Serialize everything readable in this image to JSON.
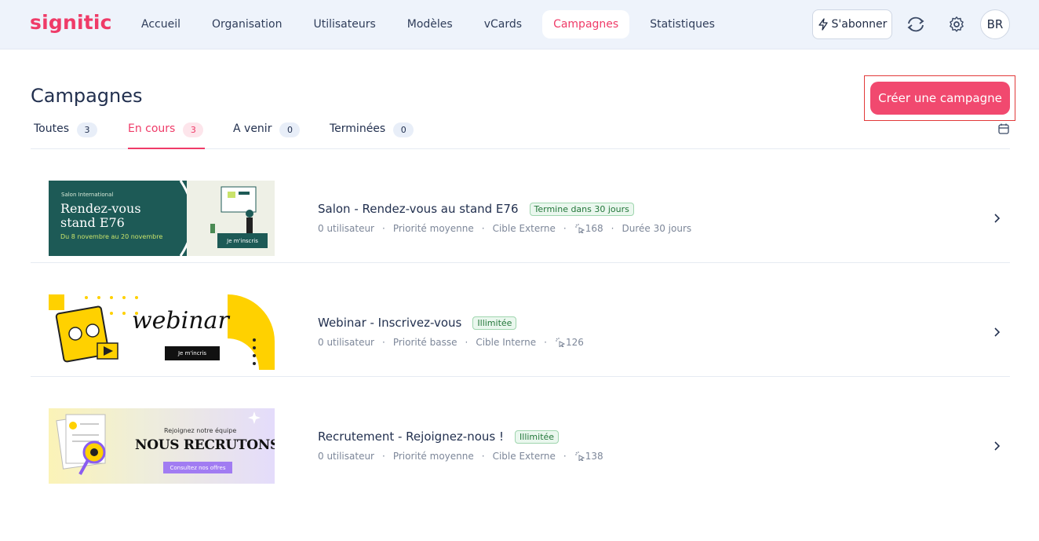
{
  "header": {
    "logo": "signitic",
    "nav": [
      "Accueil",
      "Organisation",
      "Utilisateurs",
      "Modèles",
      "vCards",
      "Campagnes",
      "Statistiques"
    ],
    "active_nav": "Campagnes",
    "subscribe_label": "S'abonner",
    "avatar_initials": "BR"
  },
  "page": {
    "title": "Campagnes",
    "create_label": "Créer une campagne"
  },
  "tabs": [
    {
      "label": "Toutes",
      "count": "3"
    },
    {
      "label": "En cours",
      "count": "3"
    },
    {
      "label": "A venir",
      "count": "0"
    },
    {
      "label": "Terminées",
      "count": "0"
    }
  ],
  "campaigns": [
    {
      "title": "Salon - Rendez-vous au stand E76",
      "status": "Termine dans 30 jours",
      "meta": [
        "0 utilisateur",
        "Priorité moyenne",
        "Cible Externe"
      ],
      "clicks": "168",
      "duration": "Durée 30 jours",
      "banner": {
        "small": "Salon International",
        "line1": "Rendez-vous",
        "line2": "stand E76",
        "dates": "Du 8 novembre au 20 novembre",
        "cta": "Je m'inscris"
      }
    },
    {
      "title": "Webinar - Inscrivez-vous",
      "status": "Illimitée",
      "meta": [
        "0 utilisateur",
        "Priorité basse",
        "Cible Interne"
      ],
      "clicks": "126",
      "banner": {
        "word": "webinar",
        "cta": "Je m'incris"
      }
    },
    {
      "title": "Recrutement - Rejoignez-nous !",
      "status": "Illimitée",
      "meta": [
        "0 utilisateur",
        "Priorité moyenne",
        "Cible Externe"
      ],
      "clicks": "138",
      "banner": {
        "small": "Rejoignez notre équipe",
        "big": "NOUS RECRUTONS",
        "cta": "Consultez nos offres"
      }
    }
  ],
  "colors": {
    "accent": "#ef3b68",
    "header_bg": "#eef3fb",
    "success": "#23773a"
  }
}
